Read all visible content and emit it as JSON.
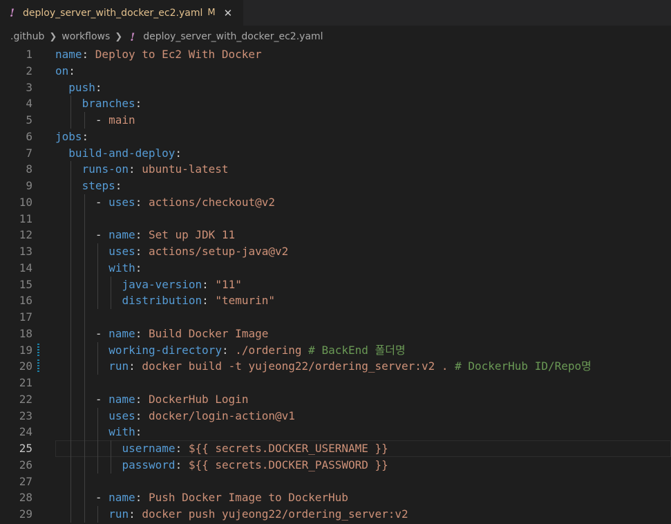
{
  "tab": {
    "icon": "yaml-exclamation-icon",
    "bang": "!",
    "filename": "deploy_server_with_docker_ec2.yaml",
    "modified": "M",
    "close": "✕"
  },
  "breadcrumb": {
    "items": [
      ".github",
      "workflows",
      "deploy_server_with_docker_ec2.yaml"
    ],
    "bang": "!"
  },
  "colors": {
    "key": "#569cd6",
    "string": "#ce9178",
    "comment": "#6a9955",
    "punct": "#d4d4d4",
    "background": "#1e1e1e"
  },
  "editor": {
    "active_line": 25,
    "lines": [
      {
        "n": "1",
        "indent": 0,
        "segs": [
          {
            "t": "k",
            "v": "name"
          },
          {
            "t": "p",
            "v": ": "
          },
          {
            "t": "s",
            "v": "Deploy to Ec2 With Docker"
          }
        ]
      },
      {
        "n": "2",
        "indent": 0,
        "segs": [
          {
            "t": "k",
            "v": "on"
          },
          {
            "t": "p",
            "v": ":"
          }
        ]
      },
      {
        "n": "3",
        "indent": 1,
        "segs": [
          {
            "t": "k",
            "v": "push"
          },
          {
            "t": "p",
            "v": ":"
          }
        ]
      },
      {
        "n": "4",
        "indent": 2,
        "segs": [
          {
            "t": "k",
            "v": "branches"
          },
          {
            "t": "p",
            "v": ":"
          }
        ]
      },
      {
        "n": "5",
        "indent": 3,
        "segs": [
          {
            "t": "p",
            "v": "- "
          },
          {
            "t": "s",
            "v": "main"
          }
        ]
      },
      {
        "n": "6",
        "indent": 0,
        "segs": [
          {
            "t": "k",
            "v": "jobs"
          },
          {
            "t": "p",
            "v": ":"
          }
        ]
      },
      {
        "n": "7",
        "indent": 1,
        "segs": [
          {
            "t": "k",
            "v": "build-and-deploy"
          },
          {
            "t": "p",
            "v": ":"
          }
        ]
      },
      {
        "n": "8",
        "indent": 2,
        "segs": [
          {
            "t": "k",
            "v": "runs-on"
          },
          {
            "t": "p",
            "v": ": "
          },
          {
            "t": "s",
            "v": "ubuntu-latest"
          }
        ]
      },
      {
        "n": "9",
        "indent": 2,
        "segs": [
          {
            "t": "k",
            "v": "steps"
          },
          {
            "t": "p",
            "v": ":"
          }
        ]
      },
      {
        "n": "10",
        "indent": 3,
        "segs": [
          {
            "t": "p",
            "v": "- "
          },
          {
            "t": "k",
            "v": "uses"
          },
          {
            "t": "p",
            "v": ": "
          },
          {
            "t": "s",
            "v": "actions/checkout@v2"
          }
        ]
      },
      {
        "n": "11",
        "indent": 3,
        "segs": []
      },
      {
        "n": "12",
        "indent": 3,
        "segs": [
          {
            "t": "p",
            "v": "- "
          },
          {
            "t": "k",
            "v": "name"
          },
          {
            "t": "p",
            "v": ": "
          },
          {
            "t": "s",
            "v": "Set up JDK 11"
          }
        ]
      },
      {
        "n": "13",
        "indent": 4,
        "segs": [
          {
            "t": "k",
            "v": "uses"
          },
          {
            "t": "p",
            "v": ": "
          },
          {
            "t": "s",
            "v": "actions/setup-java@v2"
          }
        ]
      },
      {
        "n": "14",
        "indent": 4,
        "segs": [
          {
            "t": "k",
            "v": "with"
          },
          {
            "t": "p",
            "v": ":"
          }
        ]
      },
      {
        "n": "15",
        "indent": 5,
        "segs": [
          {
            "t": "k",
            "v": "java-version"
          },
          {
            "t": "p",
            "v": ": "
          },
          {
            "t": "s",
            "v": "\"11\""
          }
        ]
      },
      {
        "n": "16",
        "indent": 5,
        "segs": [
          {
            "t": "k",
            "v": "distribution"
          },
          {
            "t": "p",
            "v": ": "
          },
          {
            "t": "s",
            "v": "\"temurin\""
          }
        ]
      },
      {
        "n": "17",
        "indent": 3,
        "segs": []
      },
      {
        "n": "18",
        "indent": 3,
        "segs": [
          {
            "t": "p",
            "v": "- "
          },
          {
            "t": "k",
            "v": "name"
          },
          {
            "t": "p",
            "v": ": "
          },
          {
            "t": "s",
            "v": "Build Docker Image"
          }
        ]
      },
      {
        "n": "19",
        "indent": 4,
        "mod": true,
        "segs": [
          {
            "t": "k",
            "v": "working-directory"
          },
          {
            "t": "p",
            "v": ": "
          },
          {
            "t": "s",
            "v": "./ordering"
          },
          {
            "t": "c",
            "v": " # BackEnd 폴더명"
          }
        ]
      },
      {
        "n": "20",
        "indent": 4,
        "mod": true,
        "segs": [
          {
            "t": "k",
            "v": "run"
          },
          {
            "t": "p",
            "v": ": "
          },
          {
            "t": "s",
            "v": "docker build -t yujeong22/ordering_server:v2 ."
          },
          {
            "t": "c",
            "v": " # DockerHub ID/Repo명"
          }
        ]
      },
      {
        "n": "21",
        "indent": 3,
        "segs": []
      },
      {
        "n": "22",
        "indent": 3,
        "segs": [
          {
            "t": "p",
            "v": "- "
          },
          {
            "t": "k",
            "v": "name"
          },
          {
            "t": "p",
            "v": ": "
          },
          {
            "t": "s",
            "v": "DockerHub Login"
          }
        ]
      },
      {
        "n": "23",
        "indent": 4,
        "segs": [
          {
            "t": "k",
            "v": "uses"
          },
          {
            "t": "p",
            "v": ": "
          },
          {
            "t": "s",
            "v": "docker/login-action@v1"
          }
        ]
      },
      {
        "n": "24",
        "indent": 4,
        "segs": [
          {
            "t": "k",
            "v": "with"
          },
          {
            "t": "p",
            "v": ":"
          }
        ]
      },
      {
        "n": "25",
        "indent": 5,
        "segs": [
          {
            "t": "k",
            "v": "username"
          },
          {
            "t": "p",
            "v": ": "
          },
          {
            "t": "s",
            "v": "${{ secrets.DOCKER_USERNAME }}"
          }
        ]
      },
      {
        "n": "26",
        "indent": 5,
        "segs": [
          {
            "t": "k",
            "v": "password"
          },
          {
            "t": "p",
            "v": ": "
          },
          {
            "t": "s",
            "v": "${{ secrets.DOCKER_PASSWORD }}"
          }
        ]
      },
      {
        "n": "27",
        "indent": 3,
        "segs": []
      },
      {
        "n": "28",
        "indent": 3,
        "segs": [
          {
            "t": "p",
            "v": "- "
          },
          {
            "t": "k",
            "v": "name"
          },
          {
            "t": "p",
            "v": ": "
          },
          {
            "t": "s",
            "v": "Push Docker Image to DockerHub"
          }
        ]
      },
      {
        "n": "29",
        "indent": 4,
        "segs": [
          {
            "t": "k",
            "v": "run"
          },
          {
            "t": "p",
            "v": ": "
          },
          {
            "t": "s",
            "v": "docker push yujeong22/ordering_server:v2"
          }
        ]
      }
    ]
  }
}
